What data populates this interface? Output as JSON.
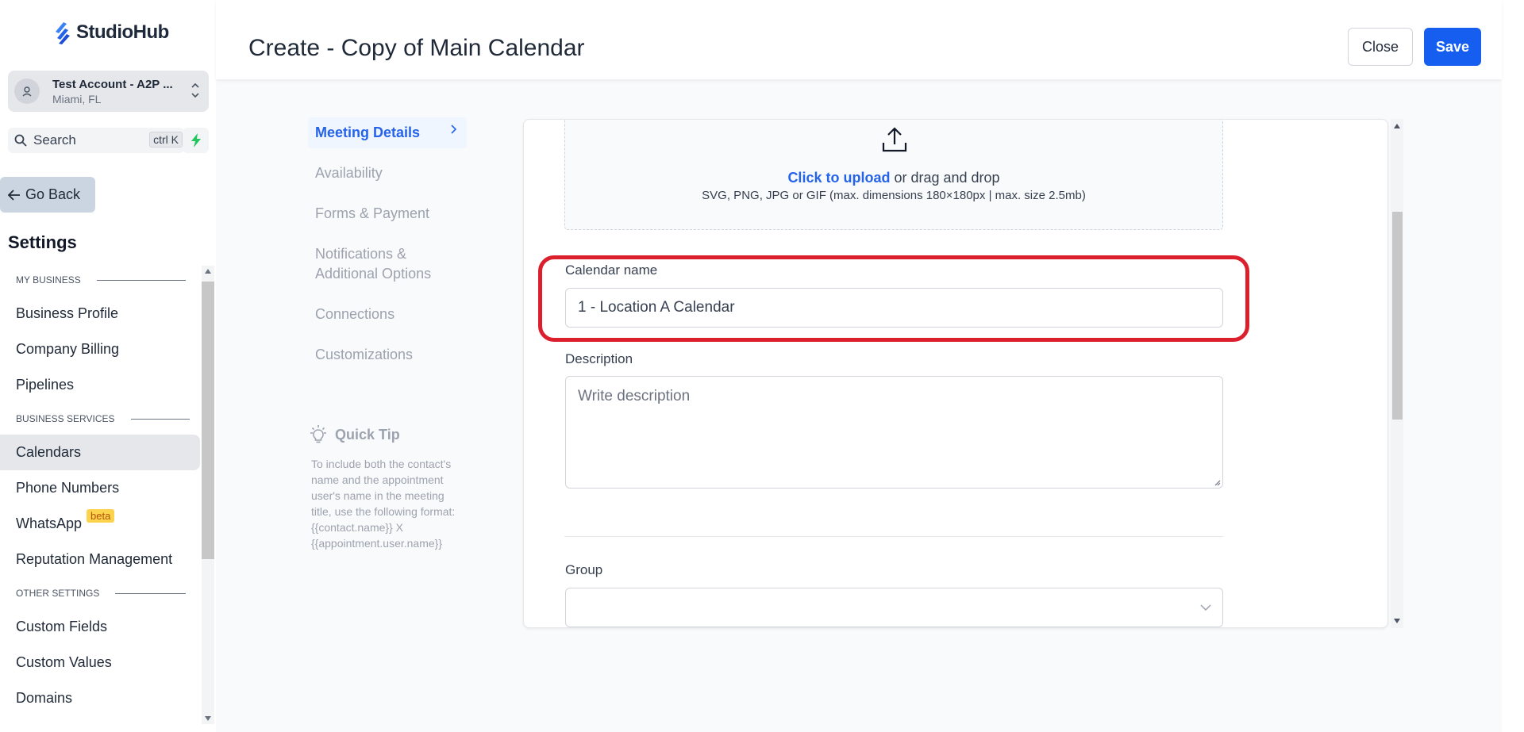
{
  "brand": {
    "name": "StudioHub",
    "accent": "#155eef"
  },
  "account": {
    "name": "Test Account - A2P ...",
    "location": "Miami, FL"
  },
  "search": {
    "label": "Search",
    "shortcut": "ctrl K"
  },
  "go_back": "Go Back",
  "settings_title": "Settings",
  "sidebar": {
    "sections": [
      {
        "title": "MY BUSINESS",
        "items": [
          {
            "label": "Business Profile"
          },
          {
            "label": "Company Billing"
          },
          {
            "label": "Pipelines"
          }
        ]
      },
      {
        "title": "BUSINESS SERVICES",
        "items": [
          {
            "label": "Calendars",
            "active": true
          },
          {
            "label": "Phone Numbers"
          },
          {
            "label": "WhatsApp",
            "badge": "beta"
          },
          {
            "label": "Reputation Management"
          }
        ]
      },
      {
        "title": "OTHER SETTINGS",
        "items": [
          {
            "label": "Custom Fields"
          },
          {
            "label": "Custom Values"
          },
          {
            "label": "Domains"
          }
        ]
      }
    ]
  },
  "header": {
    "title": "Create - Copy of Main Calendar",
    "close_label": "Close",
    "save_label": "Save"
  },
  "subnav": [
    {
      "label": "Meeting Details",
      "active": true
    },
    {
      "label": "Availability"
    },
    {
      "label": "Forms & Payment"
    },
    {
      "label": "Notifications & Additional Options"
    },
    {
      "label": "Connections"
    },
    {
      "label": "Customizations"
    }
  ],
  "quick_tip": {
    "title": "Quick Tip",
    "body": "To include both the contact's name and the appointment user's name in the meeting title, use the following format: {{contact.name}} X {{appointment.user.name}}"
  },
  "form": {
    "upload": {
      "link_text": "Click to upload",
      "rest_text": " or drag and drop",
      "hint": "SVG, PNG, JPG or GIF (max. dimensions 180×180px | max. size 2.5mb)"
    },
    "calendar_name": {
      "label": "Calendar name",
      "value": "1 - Location A Calendar"
    },
    "description": {
      "label": "Description",
      "placeholder": "Write description"
    },
    "group": {
      "label": "Group",
      "value": ""
    }
  }
}
